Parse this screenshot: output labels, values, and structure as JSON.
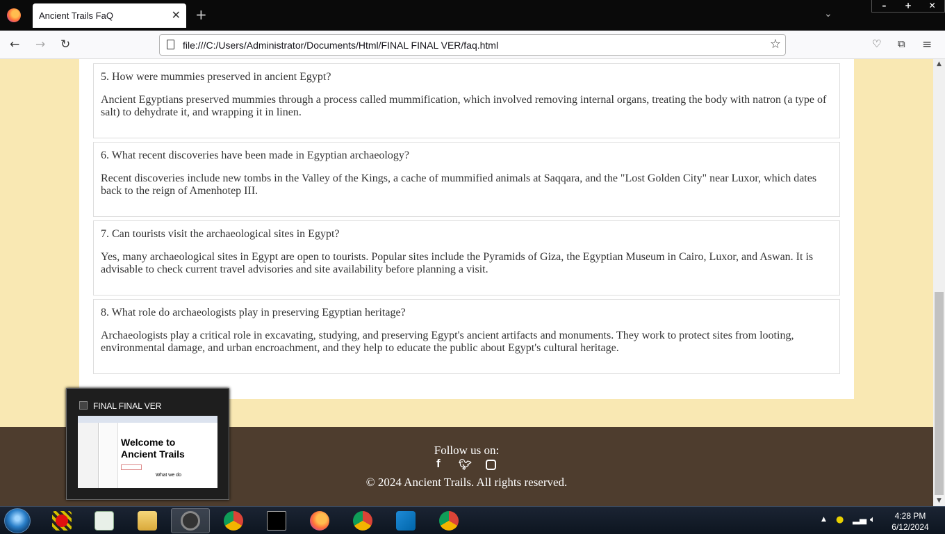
{
  "browser": {
    "tab_title": "Ancient Trails FaQ",
    "url": "file:///C:/Users/Administrator/Documents/Html/FINAL FINAL VER/faq.html"
  },
  "faqs": [
    {
      "question": "5. How were mummies preserved in ancient Egypt?",
      "answer": "Ancient Egyptians preserved mummies through a process called mummification, which involved removing internal organs, treating the body with natron (a type of salt) to dehydrate it, and wrapping it in linen."
    },
    {
      "question": "6. What recent discoveries have been made in Egyptian archaeology?",
      "answer": "Recent discoveries include new tombs in the Valley of the Kings, a cache of mummified animals at Saqqara, and the \"Lost Golden City\" near Luxor, which dates back to the reign of Amenhotep III."
    },
    {
      "question": "7. Can tourists visit the archaeological sites in Egypt?",
      "answer": "Yes, many archaeological sites in Egypt are open to tourists. Popular sites include the Pyramids of Giza, the Egyptian Museum in Cairo, Luxor, and Aswan. It is advisable to check current travel advisories and site availability before planning a visit."
    },
    {
      "question": "8. What role do archaeologists play in preserving Egyptian heritage?",
      "answer": "Archaeologists play a critical role in excavating, studying, and preserving Egypt's ancient artifacts and monuments. They work to protect sites from looting, environmental damage, and urban encroachment, and they help to educate the public about Egypt's cultural heritage."
    }
  ],
  "footer": {
    "follow": "Follow us on:",
    "social_icons": [
      "facebook-icon",
      "twitter-icon",
      "instagram-icon"
    ],
    "copyright": "© 2024 Ancient Trails. All rights reserved."
  },
  "preview": {
    "title": "FINAL FINAL VER",
    "heading": "Welcome to Ancient Trails",
    "subtext": "What we do"
  },
  "taskbar": {
    "time": "4:28 PM",
    "date": "6/12/2024"
  },
  "colors": {
    "page_bg": "#f9e8b3",
    "footer_bg": "#4e3d2e"
  }
}
